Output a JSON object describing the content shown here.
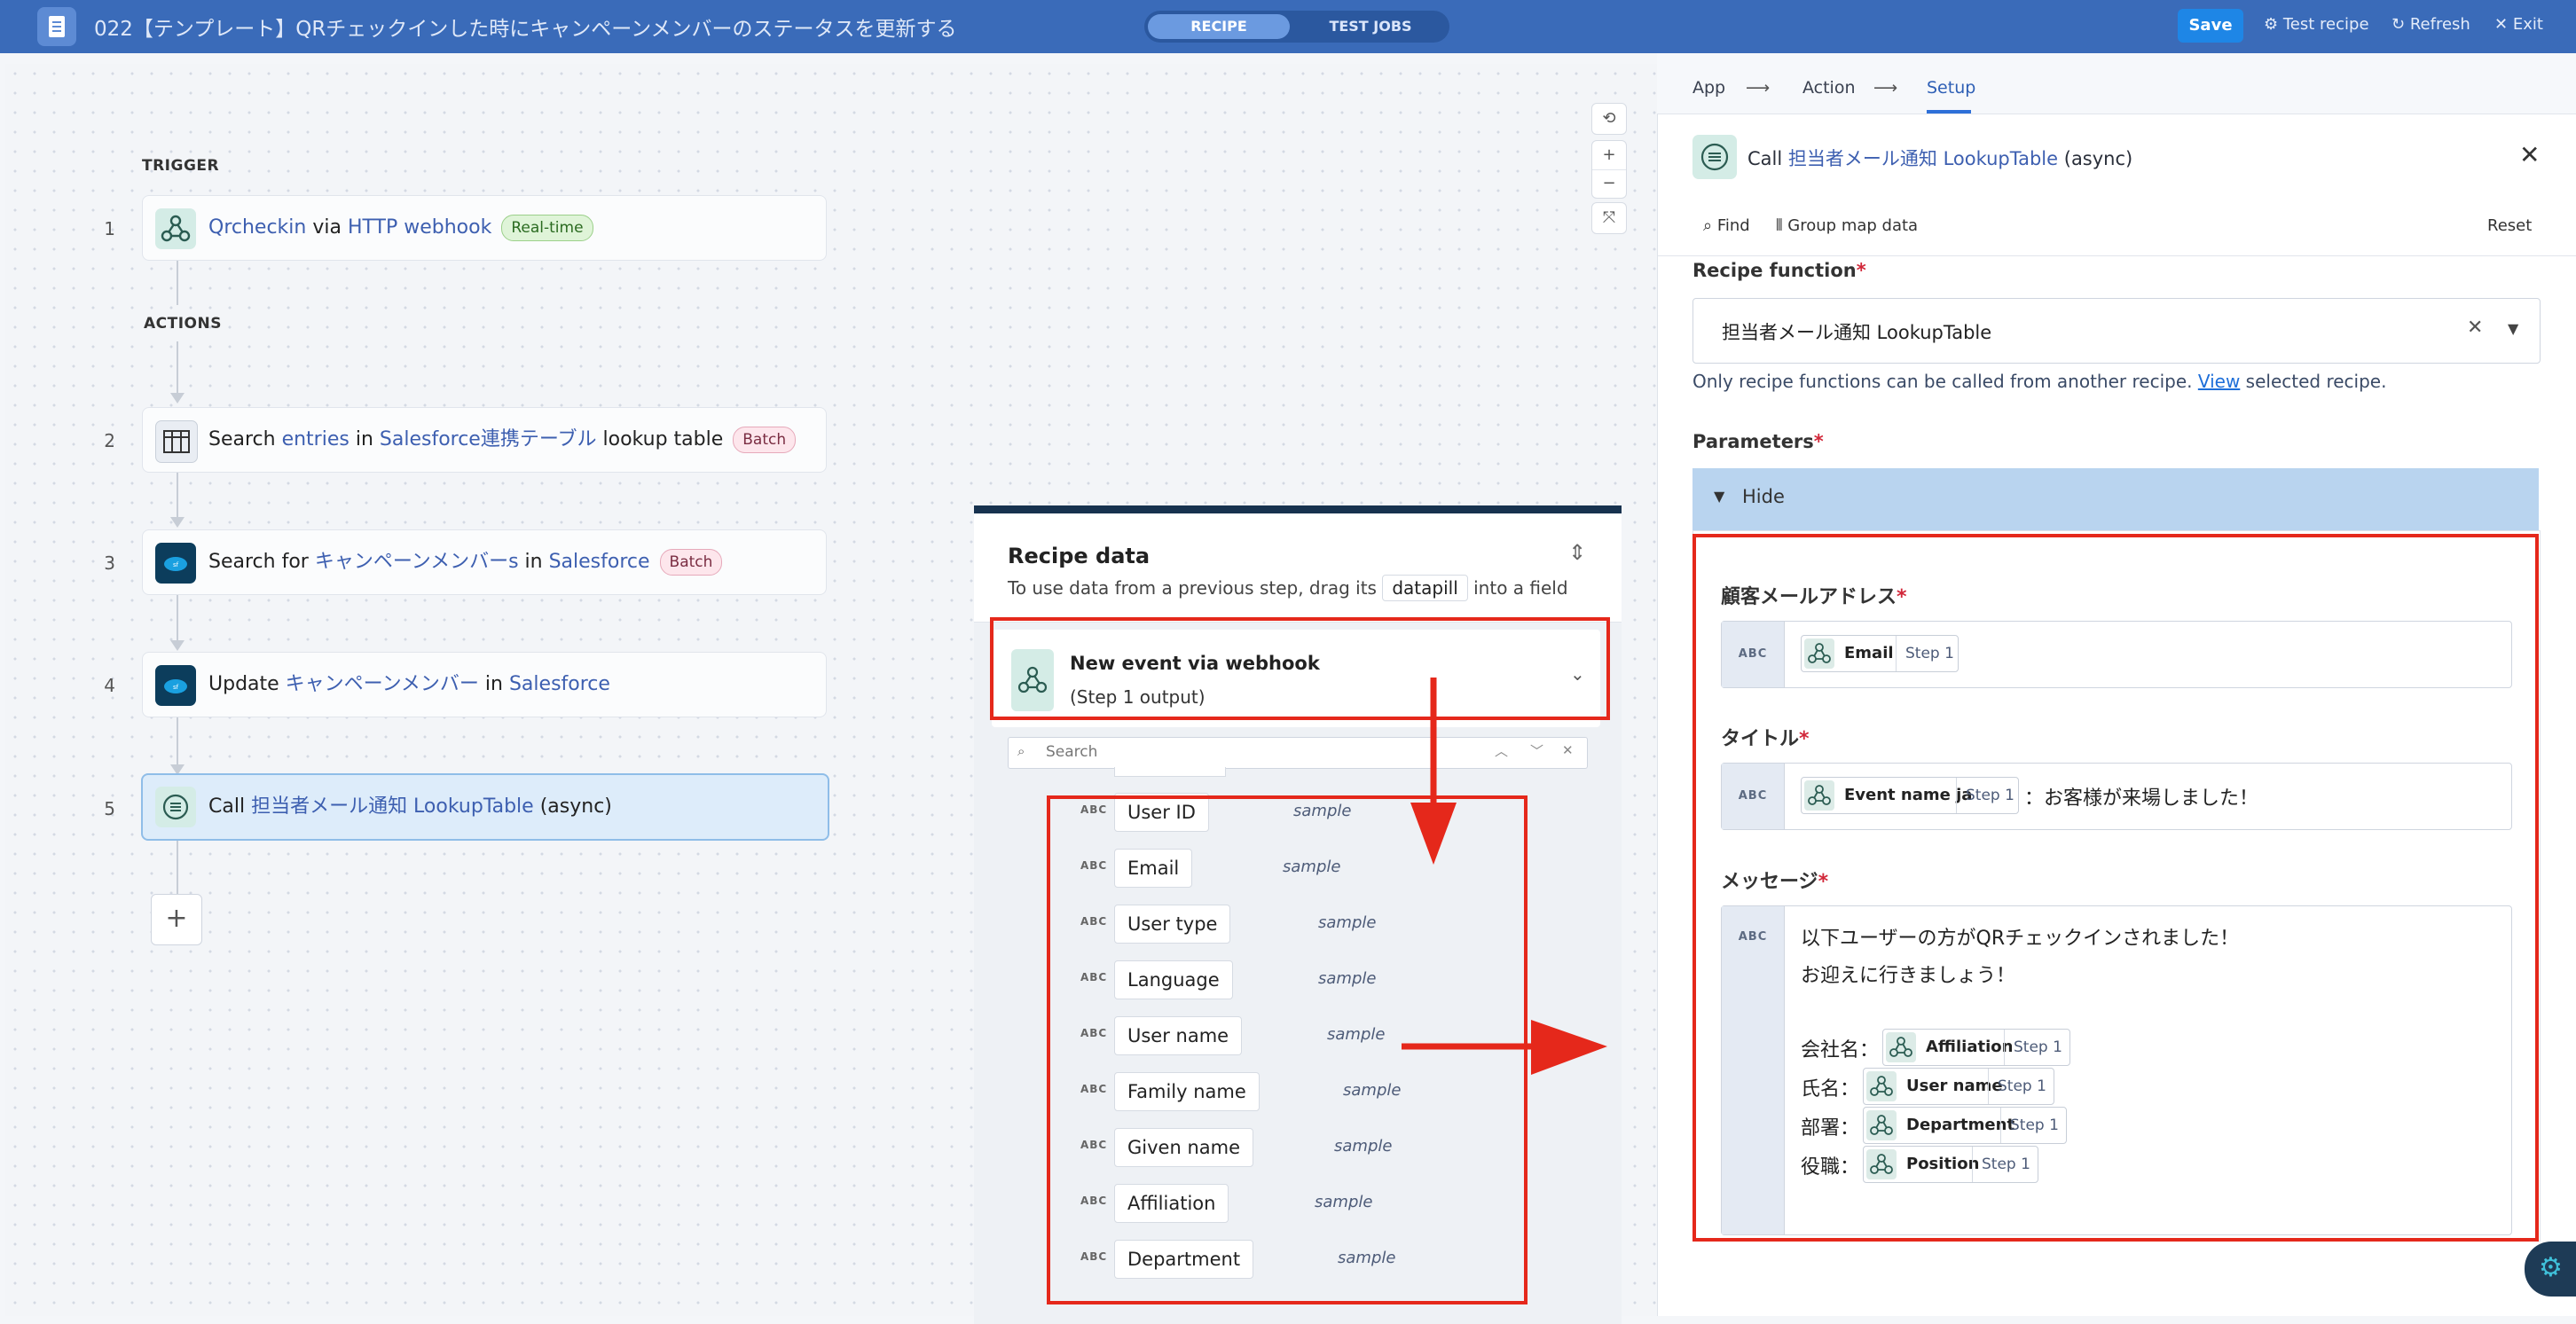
{
  "header": {
    "title": "022【テンプレート】QRチェックインした時にキャンペーンメンバーのステータスを更新する",
    "toggle": [
      "RECIPE",
      "TEST JOBS"
    ],
    "save": "Save",
    "test_recipe": "Test recipe",
    "refresh": "Refresh",
    "exit": "Exit"
  },
  "canvas": {
    "trigger_label": "TRIGGER",
    "actions_label": "ACTIONS",
    "steps": [
      {
        "num": "1",
        "parts": [
          "Qrcheckin",
          " via ",
          "HTTP webhook"
        ],
        "badge": "Real-time"
      },
      {
        "num": "2",
        "parts": [
          "Search ",
          "entries",
          " in ",
          "Salesforce連携テーブル",
          " lookup table"
        ],
        "badge": "Batch"
      },
      {
        "num": "3",
        "parts": [
          "Search for ",
          "キャンペーンメンバーs",
          " in ",
          "Salesforce"
        ],
        "badge": "Batch"
      },
      {
        "num": "4",
        "parts": [
          "Update ",
          "キャンペーンメンバー",
          " in ",
          "Salesforce"
        ]
      },
      {
        "num": "5",
        "parts": [
          "Call ",
          "担当者メール通知 LookupTable",
          " (async)"
        ]
      }
    ],
    "add": "+"
  },
  "recipe_data": {
    "title": "Recipe data",
    "hint_pre": "To use data from a previous step, drag its",
    "hint_pill": "datapill",
    "hint_post": "into a field",
    "source_title": "New event via webhook",
    "source_sub": "(Step 1 output)",
    "search_placeholder": "Search",
    "abc": "ABC",
    "sample": "sample",
    "fields": [
      "User ID",
      "Email",
      "User type",
      "Language",
      "User name",
      "Family name",
      "Given name",
      "Affiliation",
      "Department"
    ]
  },
  "setup": {
    "crumbs": [
      "App",
      "Action",
      "Setup"
    ],
    "call_pre": "Call",
    "call_link": "担当者メール通知 LookupTable",
    "call_post": "(async)",
    "find": "Find",
    "group_map": "Group map data",
    "reset": "Reset",
    "recipe_function_label": "Recipe function",
    "recipe_function_value": "担当者メール通知 LookupTable",
    "hint_pre": "Only recipe functions can be called from another recipe.",
    "hint_link": "View",
    "hint_post": "selected recipe.",
    "parameters_label": "Parameters",
    "hide": "Hide",
    "abc": "ABC",
    "step_tag": "Step 1",
    "email_label": "顧客メールアドレス",
    "email_pill": "Email",
    "title_label": "タイトル",
    "title_pill": "Event name ja",
    "title_text": "：お客様が来場しました！",
    "message_label": "メッセージ",
    "message_line1": "以下ユーザーの方がQRチェックインされました！",
    "message_line2": "お迎えに行きましょう！",
    "msg_rows": [
      {
        "label": "会社名：",
        "pill": "Affiliation"
      },
      {
        "label": "氏名：",
        "pill": "User name"
      },
      {
        "label": "部署：",
        "pill": "Department"
      },
      {
        "label": "役職：",
        "pill": "Position"
      }
    ]
  },
  "colors": {
    "accent": "#3a6bb9",
    "annotation": "#e5281b",
    "link": "#3d5fb0"
  }
}
